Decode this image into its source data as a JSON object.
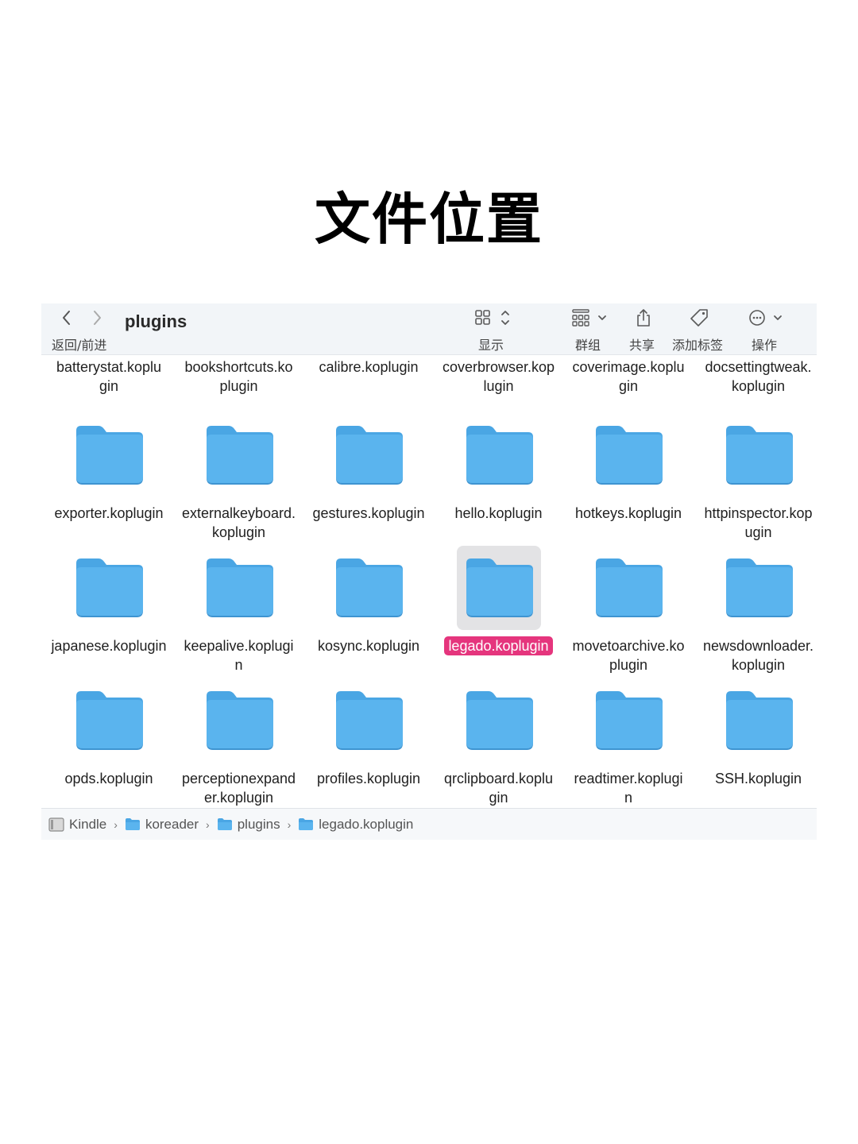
{
  "page_title": "文件位置",
  "window": {
    "title": "plugins",
    "nav_label": "返回/前进",
    "toolbar": [
      {
        "id": "view",
        "icon": "grid-view-icon",
        "label": "显示"
      },
      {
        "id": "group",
        "icon": "group-icon",
        "label": "群组"
      },
      {
        "id": "share",
        "icon": "share-icon",
        "label": "共享"
      },
      {
        "id": "tag",
        "icon": "tag-icon",
        "label": "添加标签"
      },
      {
        "id": "action",
        "icon": "more-icon",
        "label": "操作"
      }
    ]
  },
  "rows": [
    {
      "top_partial": true,
      "items": [
        [
          "batterystat.koplu",
          "gin"
        ],
        [
          "bookshortcuts.ko",
          "plugin"
        ],
        [
          "calibre.koplugin"
        ],
        [
          "coverbrowser.kop",
          "lugin"
        ],
        [
          "coverimage.koplu",
          "gin"
        ],
        [
          "docsettingtweak.",
          "koplugin"
        ]
      ]
    },
    {
      "items": [
        [
          "exporter.koplugin"
        ],
        [
          "externalkeyboard.",
          "koplugin"
        ],
        [
          "gestures.koplugin"
        ],
        [
          "hello.koplugin"
        ],
        [
          "hotkeys.koplugin"
        ],
        [
          "httpinspector.kop",
          "ugin"
        ]
      ]
    },
    {
      "items": [
        [
          "japanese.koplugin"
        ],
        [
          "keepalive.koplugi",
          "n"
        ],
        [
          "kosync.koplugin"
        ],
        [
          "legado.koplugin"
        ],
        [
          "movetoarchive.ko",
          "plugin"
        ],
        [
          "newsdownloader.",
          "koplugin"
        ]
      ]
    },
    {
      "items": [
        [
          "opds.koplugin"
        ],
        [
          "perceptionexpand",
          "er.koplugin"
        ],
        [
          "profiles.koplugin"
        ],
        [
          "qrclipboard.koplu",
          "gin"
        ],
        [
          "readtimer.koplugi",
          "n"
        ],
        [
          "SSH.koplugin"
        ]
      ]
    }
  ],
  "selected_item": "legado.koplugin",
  "colors": {
    "folder": "#5ab4ee",
    "folder_tab": "#4aa6e4",
    "selection": "#e5357d"
  },
  "pathbar": [
    {
      "icon": "drive-icon",
      "label": "Kindle"
    },
    {
      "icon": "folder-icon",
      "label": "koreader"
    },
    {
      "icon": "folder-icon",
      "label": "plugins"
    },
    {
      "icon": "folder-icon",
      "label": "legado.koplugin"
    }
  ]
}
